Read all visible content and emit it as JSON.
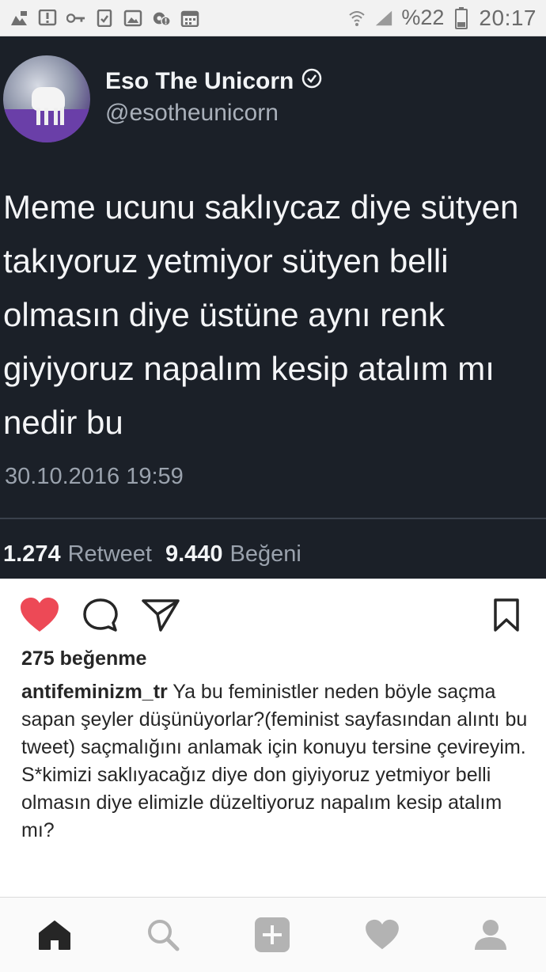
{
  "status_bar": {
    "left_icons": [
      "image-icon",
      "alert-icon",
      "key-icon",
      "clipboard-check-icon",
      "gallery-icon",
      "settings-notification-icon",
      "calendar-icon"
    ],
    "battery_percent": "%22",
    "time": "20:17"
  },
  "tweet": {
    "name": "Eso The Unicorn",
    "handle": "@esotheunicorn",
    "text": "Meme ucunu saklıycaz diye sütyen\ntakıyoruz yetmiyor sütyen belli\nolmasın diye üstüne aynı renk\ngiyiyoruz napalım kesip atalım mı\nnedir bu",
    "date": "30.10.2016 19:59",
    "retweet_count": "1.274",
    "retweet_label": "Retweet",
    "like_count": "9.440",
    "like_label": "Beğeni"
  },
  "post": {
    "likes_text": "275 beğenme",
    "username": "antifeminizm_tr",
    "caption_line1": "Ya bu feministler neden böyle saçma sapan şeyler düşünüyorlar?(feminist sayfasından alıntı bu tweet) saçmalığını anlamak için konuyu tersine çevireyim.",
    "caption_line2": "S*kimizi saklıyacağız diye don giyiyoruz yetmiyor belli olmasın diye elimizle düzeltiyoruz napalım kesip atalım mı?"
  },
  "colors": {
    "heart": "#ed4956",
    "tweet_bg": "#1b2028",
    "icon": "#262626",
    "nav_icon": "#b3b3b3"
  }
}
